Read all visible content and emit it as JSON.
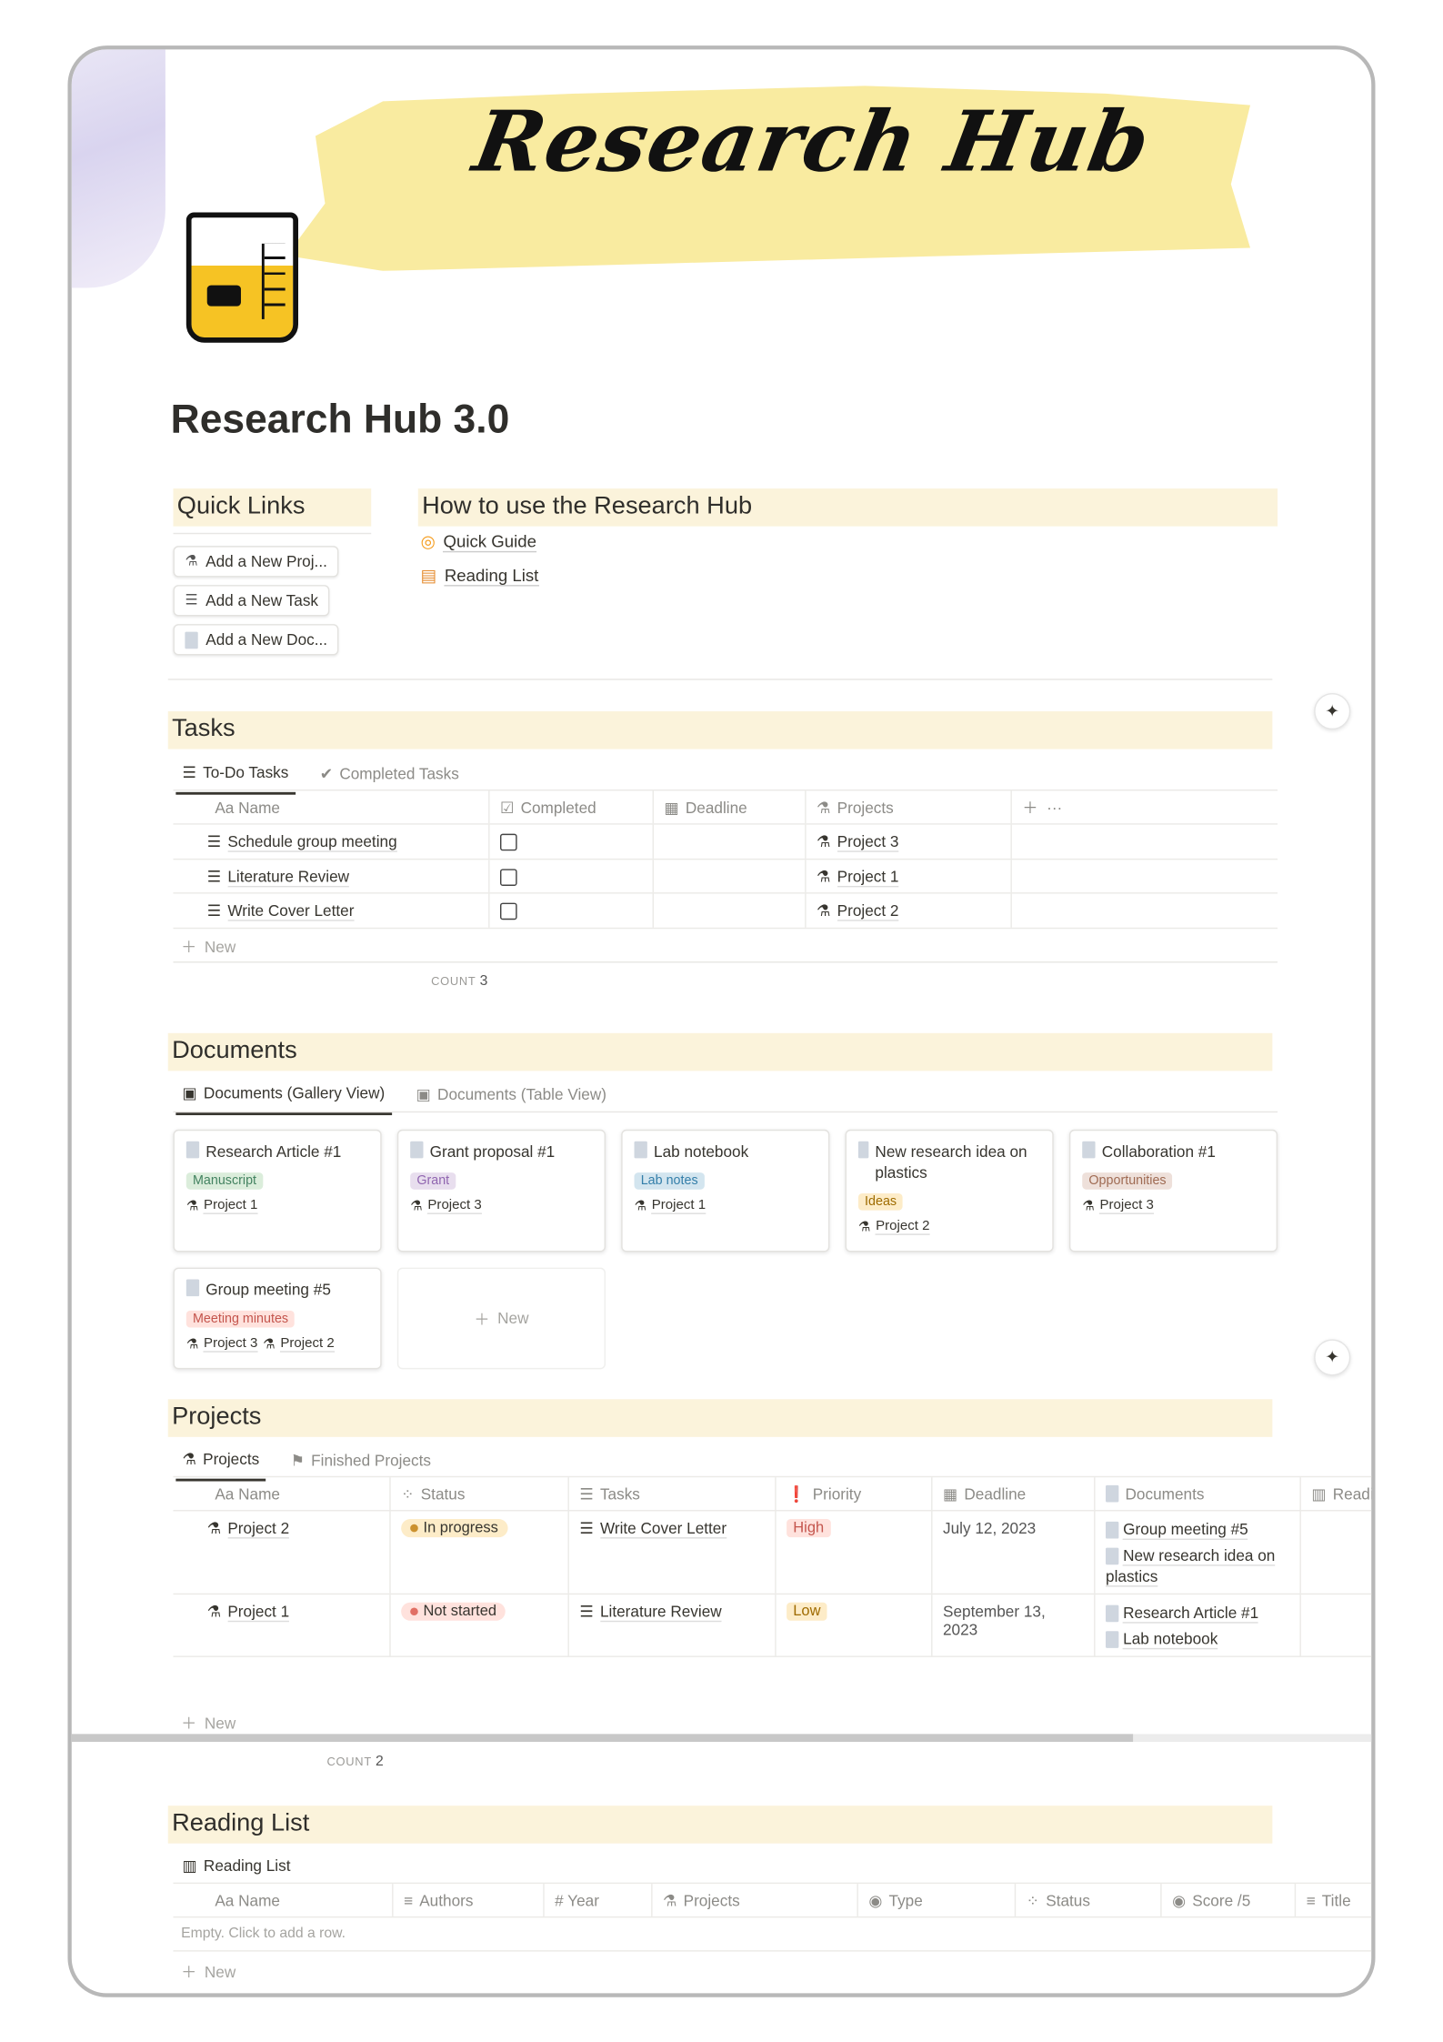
{
  "cover": {
    "banner_title": "Research Hub",
    "banner_color": "#f9eba0"
  },
  "page": {
    "title": "Research Hub 3.0"
  },
  "quick_links": {
    "heading": "Quick Links",
    "buttons": [
      "Add a New Proj...",
      "Add a New Task",
      "Add a New Doc..."
    ]
  },
  "how_to": {
    "heading": "How to use the Research Hub",
    "links": [
      "Quick Guide",
      "Reading List"
    ]
  },
  "tasks": {
    "heading": "Tasks",
    "tabs": [
      "To-Do Tasks",
      "Completed Tasks"
    ],
    "columns": [
      "Aa Name",
      "Completed",
      "Deadline",
      "Projects"
    ],
    "rows": [
      {
        "name": "Schedule group meeting",
        "completed": false,
        "deadline": "",
        "project": "Project 3"
      },
      {
        "name": "Literature Review",
        "completed": false,
        "deadline": "",
        "project": "Project 1"
      },
      {
        "name": "Write Cover Letter",
        "completed": false,
        "deadline": "",
        "project": "Project 2"
      }
    ],
    "new_label": "New",
    "count_label": "COUNT",
    "count": "3"
  },
  "documents": {
    "heading": "Documents",
    "tabs": [
      "Documents (Gallery View)",
      "Documents (Table View)"
    ],
    "cards": [
      {
        "title": "Research Article #1",
        "tag": "Manuscript",
        "tag_bg": "#dbeddb",
        "tag_fg": "#448361",
        "projects": [
          "Project 1"
        ]
      },
      {
        "title": "Grant proposal #1",
        "tag": "Grant",
        "tag_bg": "#e8deee",
        "tag_fg": "#9065b0",
        "projects": [
          "Project 3"
        ]
      },
      {
        "title": "Lab notebook",
        "tag": "Lab notes",
        "tag_bg": "#d3e5ef",
        "tag_fg": "#337ea9",
        "projects": [
          "Project 1"
        ]
      },
      {
        "title": "New research idea on plastics",
        "tag": "Ideas",
        "tag_bg": "#fdecc8",
        "tag_fg": "#9f6b00",
        "projects": [
          "Project 2"
        ]
      },
      {
        "title": "Collaboration #1",
        "tag": "Opportunities",
        "tag_bg": "#eee0da",
        "tag_fg": "#9f6b53",
        "projects": [
          "Project 3"
        ]
      },
      {
        "title": "Group meeting #5",
        "tag": "Meeting minutes",
        "tag_bg": "#ffe2dd",
        "tag_fg": "#c4554d",
        "projects": [
          "Project 3",
          "Project 2"
        ]
      }
    ],
    "new_label": "New"
  },
  "projects": {
    "heading": "Projects",
    "tabs": [
      "Projects",
      "Finished Projects"
    ],
    "columns": [
      "Aa Name",
      "Status",
      "Tasks",
      "Priority",
      "Deadline",
      "Documents",
      "Readin"
    ],
    "rows": [
      {
        "name": "Project 2",
        "status": "In progress",
        "status_bg": "#fdecc8",
        "status_dot": "#cb912f",
        "task": "Write Cover Letter",
        "priority": "High",
        "priority_bg": "#ffe2dd",
        "priority_fg": "#c4554d",
        "deadline": "July 12, 2023",
        "documents": [
          "Group meeting #5",
          "New research idea on plastics"
        ]
      },
      {
        "name": "Project 1",
        "status": "Not started",
        "status_bg": "#ffe2dd",
        "status_dot": "#e16f64",
        "task": "Literature Review",
        "priority": "Low",
        "priority_bg": "#fdecc8",
        "priority_fg": "#9f6b00",
        "deadline": "September 13, 2023",
        "documents": [
          "Research Article #1",
          "Lab notebook"
        ]
      }
    ],
    "new_label": "New",
    "count_label": "COUNT",
    "count": "2"
  },
  "reading_list": {
    "heading": "Reading List",
    "tabs": [
      "Reading List"
    ],
    "columns": [
      "Aa Name",
      "Authors",
      "# Year",
      "Projects",
      "Type",
      "Status",
      "Score /5",
      "Title"
    ],
    "empty_text": "Empty. Click to add a row.",
    "new_label": "New"
  }
}
